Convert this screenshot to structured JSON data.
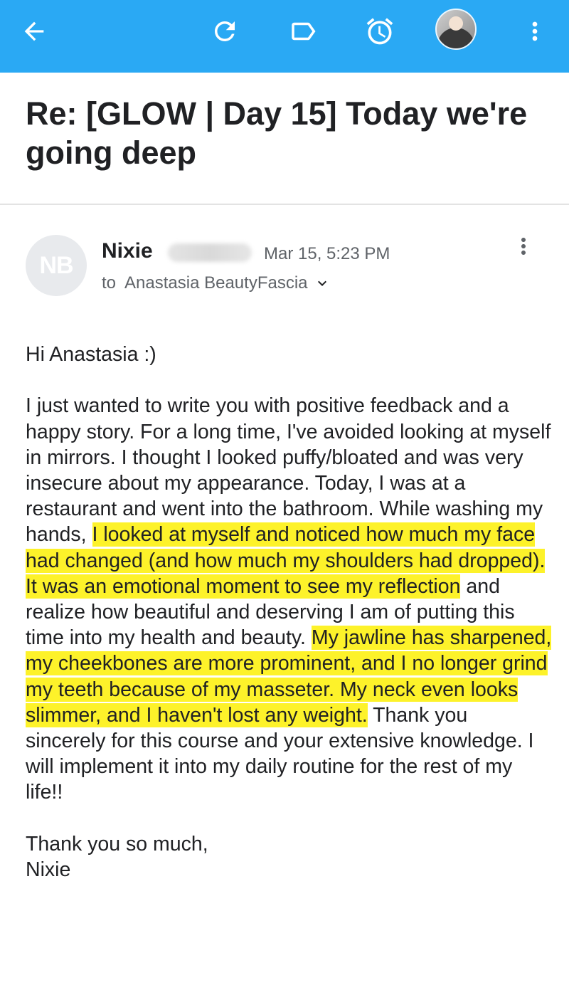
{
  "toolbar": {
    "back_icon": "arrow-back-icon",
    "refresh_icon": "refresh-icon",
    "label_icon": "label-icon",
    "snooze_icon": "alarm-clock-icon",
    "account_icon": "account-avatar",
    "more_icon": "more-vert-icon",
    "background_color": "#2aa9f4"
  },
  "email": {
    "subject": "Re: [GLOW | Day 15] Today we're going deep",
    "sender": {
      "initials": "NB",
      "name": "Nixie",
      "date": "Mar 15, 5:23 PM",
      "recipient": "to  Anastasia BeautyFascia"
    },
    "body": {
      "greeting": "Hi Anastasia :)",
      "p1_a": "I just wanted to write you with positive feedback and a happy story. For a long time, I've avoided looking at myself in mirrors. I thought I looked puffy/bloated and was very insecure about my appearance. Today, I was at a restaurant and went into the bathroom. While washing my hands, ",
      "p1_hl1": "I looked at myself and noticed how much my face had changed (and how much my shoulders had dropped). It was an emotional moment to see my reflection",
      "p1_b": " and realize how beautiful and deserving I am of putting this time into my health and beauty. ",
      "p1_hl2": "My jawline has sharpened, my cheekbones are more prominent, and I no longer grind my teeth because of my masseter. My neck even looks slimmer, and I haven't lost any weight.",
      "p1_c": " Thank you sincerely for this course and your extensive knowledge. I will implement it into my daily routine for the rest of my life!!",
      "closing": "Thank you so much,",
      "signature": "Nixie"
    },
    "highlight_color": "#fdf22a"
  }
}
